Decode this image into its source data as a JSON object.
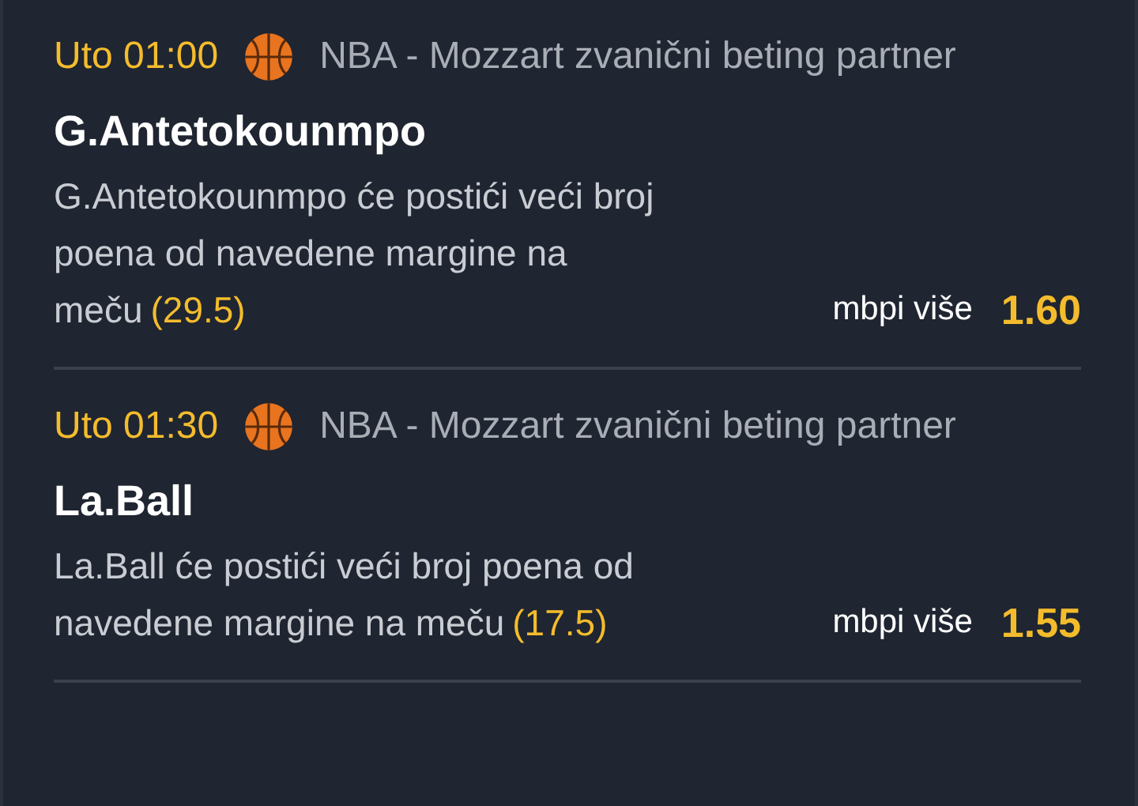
{
  "bets": [
    {
      "time": "Uto 01:00",
      "league": "NBA - Mozzart zvanični beting partner",
      "player": "G.Antetokounmpo",
      "description_lines": [
        "G.Antetokounmpo će postići veći broj",
        "poena od navedene margine na",
        "meču"
      ],
      "margin": "(29.5)",
      "market": "mbpi više",
      "odds": "1.60"
    },
    {
      "time": "Uto 01:30",
      "league": "NBA - Mozzart zvanični beting partner",
      "player": "La.Ball",
      "description_lines": [
        "La.Ball će postići veći broj poena od",
        "navedene margine na meču"
      ],
      "margin": "(17.5)",
      "market": "mbpi više",
      "odds": "1.55"
    }
  ]
}
